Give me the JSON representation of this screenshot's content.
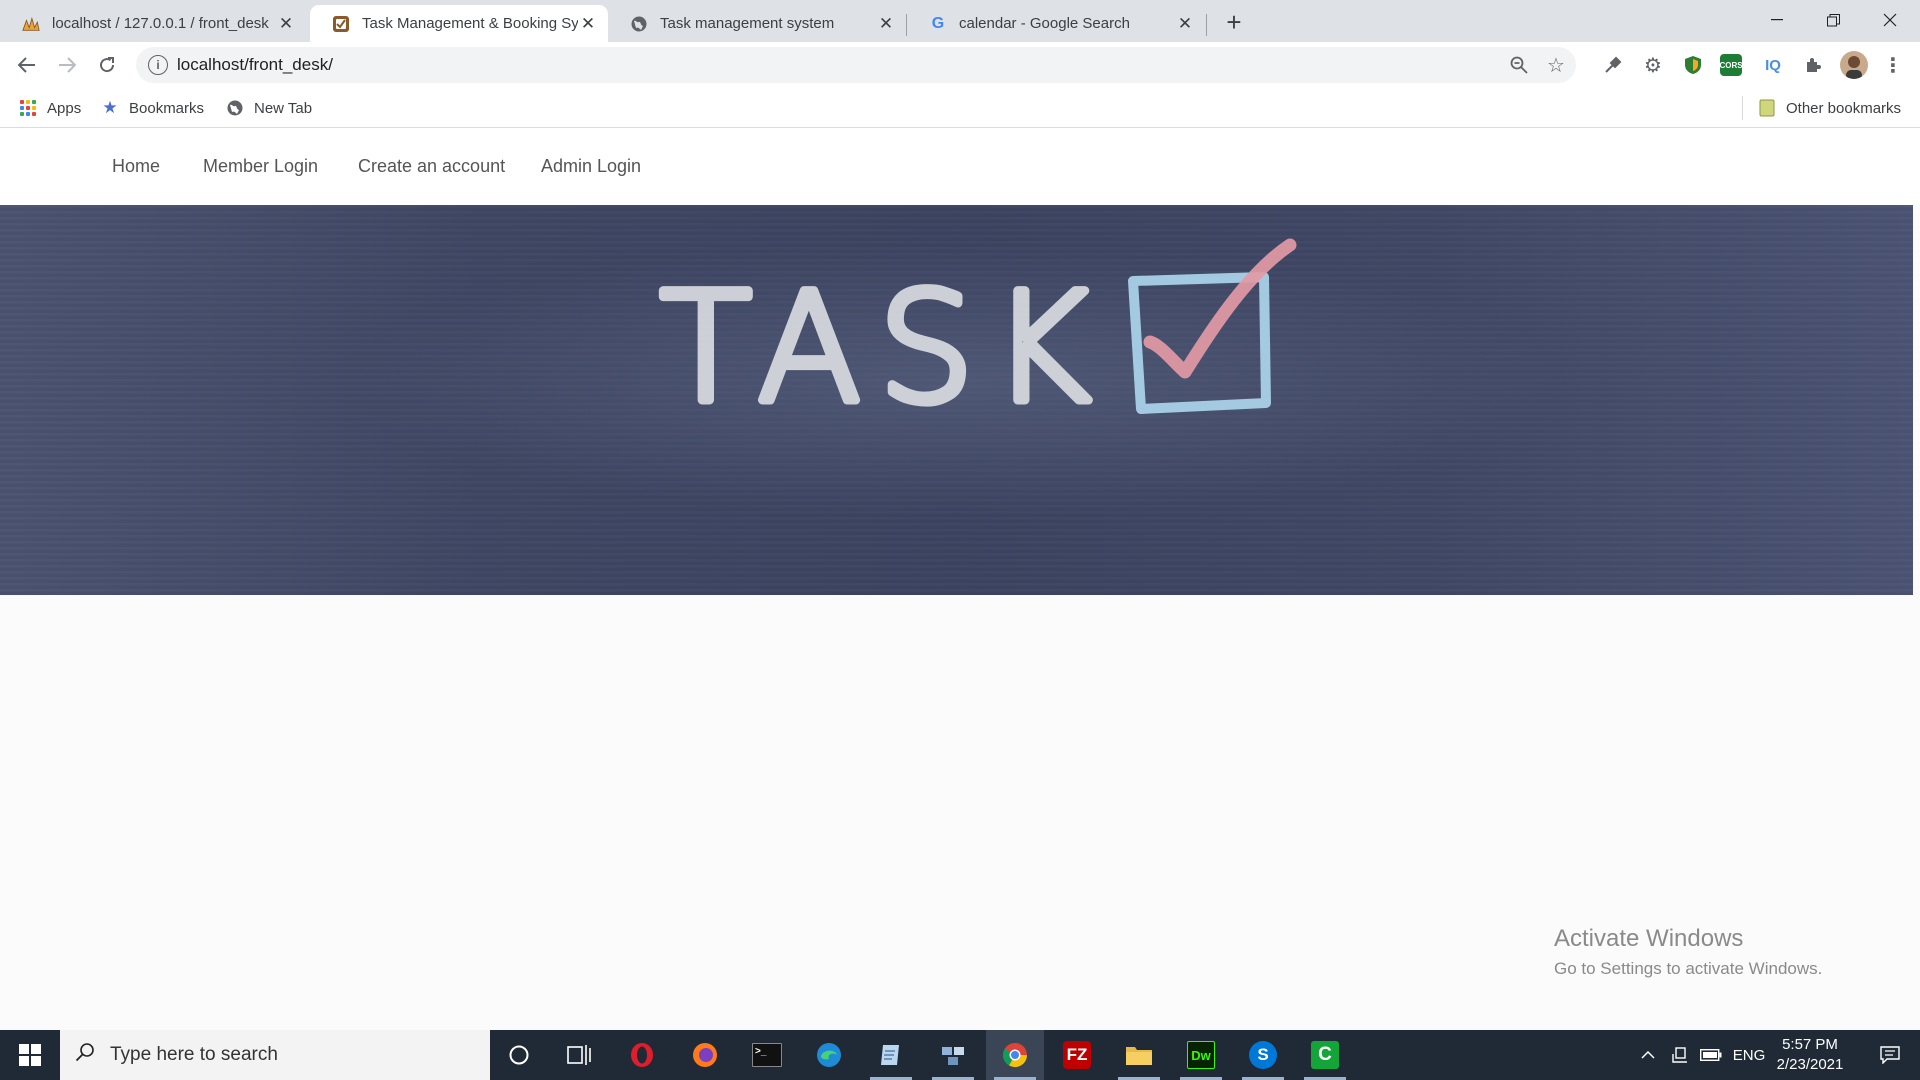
{
  "browser": {
    "tabs": [
      {
        "title": "localhost / 127.0.0.1 / front_desk",
        "icon": "phpmyadmin-icon",
        "active": false
      },
      {
        "title": "Task Management & Booking System",
        "icon": "site-icon",
        "active": true
      },
      {
        "title": "Task management system",
        "icon": "globe-icon",
        "active": false
      },
      {
        "title": "calendar - Google Search",
        "icon": "google-icon",
        "active": false
      }
    ],
    "address": "localhost/front_desk/",
    "bookmarks": [
      {
        "label": "Apps",
        "icon": "apps-grid-icon"
      },
      {
        "label": "Bookmarks",
        "icon": "star-icon"
      },
      {
        "label": "New Tab",
        "icon": "globe-icon"
      }
    ],
    "other_bookmarks": "Other bookmarks"
  },
  "site": {
    "nav": [
      "Home",
      "Member Login",
      "Create an account",
      "Admin Login"
    ],
    "hero_text": "TASK"
  },
  "watermark": {
    "line1": "Activate Windows",
    "line2": "Go to Settings to activate Windows."
  },
  "taskbar": {
    "search_placeholder": "Type here to search",
    "language": "ENG",
    "time": "5:57 PM",
    "date": "2/23/2021"
  },
  "colors": {
    "tab_strip": "#dee1e6",
    "hero_board": "#3b4360",
    "chalk": "#d9dbe0",
    "check_mark": "#e29aa5",
    "checkbox": "#a9d1e8",
    "taskbar": "#1f2a36"
  }
}
